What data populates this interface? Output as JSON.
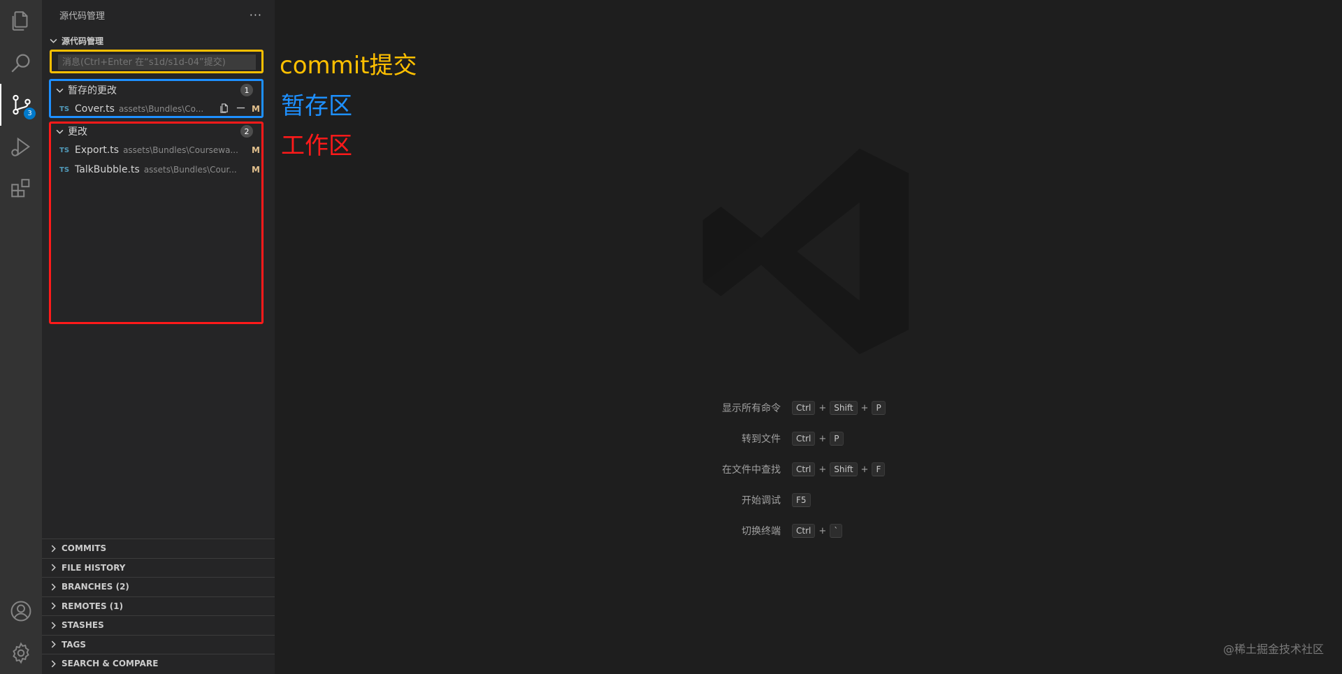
{
  "activity_bar": {
    "icons": [
      "files-icon",
      "search-icon",
      "source-control-icon",
      "run-debug-icon",
      "extensions-icon"
    ],
    "badge": "3",
    "bottom_icons": [
      "account-icon",
      "settings-gear-icon"
    ]
  },
  "sidebar": {
    "title": "源代码管理",
    "more": "···",
    "section": "源代码管理",
    "commit_placeholder": "消息(Ctrl+Enter 在“s1d/s1d-04”提交)",
    "staged": {
      "label": "暂存的更改",
      "count": "1",
      "files": [
        {
          "icon": "TS",
          "name": "Cover.ts",
          "path": "assets\\Bundles\\Co...",
          "status": "M"
        }
      ]
    },
    "changes": {
      "label": "更改",
      "count": "2",
      "files": [
        {
          "icon": "TS",
          "name": "Export.ts",
          "path": "assets\\Bundles\\Coursewa...",
          "status": "M"
        },
        {
          "icon": "TS",
          "name": "TalkBubble.ts",
          "path": "assets\\Bundles\\Cour...",
          "status": "M"
        }
      ]
    },
    "panels": [
      "COMMITS",
      "FILE HISTORY",
      "BRANCHES (2)",
      "REMOTES (1)",
      "STASHES",
      "TAGS",
      "SEARCH & COMPARE"
    ]
  },
  "annotations": {
    "commit": "commit提交",
    "staging": "暂存区",
    "working": "工作区"
  },
  "editor": {
    "shortcuts": [
      {
        "label": "显示所有命令",
        "keys": [
          "Ctrl",
          "Shift",
          "P"
        ]
      },
      {
        "label": "转到文件",
        "keys": [
          "Ctrl",
          "P"
        ]
      },
      {
        "label": "在文件中查找",
        "keys": [
          "Ctrl",
          "Shift",
          "F"
        ]
      },
      {
        "label": "开始调试",
        "keys": [
          "F5"
        ]
      },
      {
        "label": "切换终端",
        "keys": [
          "Ctrl",
          "`"
        ]
      }
    ],
    "plus": "+"
  },
  "credit": "@稀土掘金技术社区",
  "colors": {
    "commit_annotation": "#ffc000",
    "staging_annotation": "#1e90ff",
    "working_annotation": "#ff1a1a",
    "accent": "#007acc",
    "modified": "#e2c08d",
    "ts": "#519aba"
  }
}
